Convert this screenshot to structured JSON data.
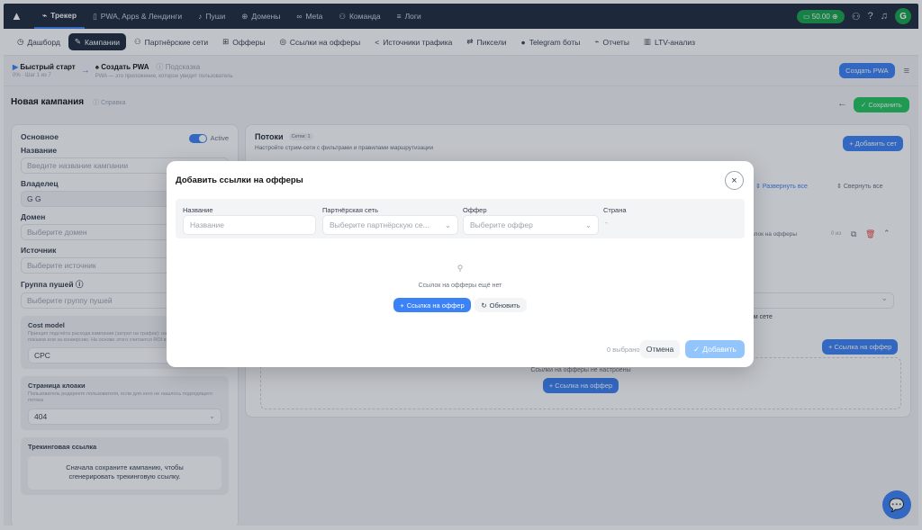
{
  "topnav": {
    "items": [
      {
        "label": "Трекер",
        "icon": "chart-icon"
      },
      {
        "label": "PWA, Apps & Лендинги",
        "icon": "phone-icon"
      },
      {
        "label": "Пуши",
        "icon": "bell-icon"
      },
      {
        "label": "Домены",
        "icon": "globe-icon"
      },
      {
        "label": "Meta",
        "icon": "infinity-icon"
      },
      {
        "label": "Команда",
        "icon": "users-icon"
      },
      {
        "label": "Логи",
        "icon": "list-icon"
      }
    ],
    "balance": "50.00",
    "avatar": "G"
  },
  "subnav": {
    "items": [
      {
        "label": "Дашборд",
        "icon": "clock-icon"
      },
      {
        "label": "Кампании",
        "icon": "edit-icon"
      },
      {
        "label": "Партнёрские сети",
        "icon": "users-icon"
      },
      {
        "label": "Офферы",
        "icon": "gift-icon"
      },
      {
        "label": "Ссылки на офферы",
        "icon": "pin-icon"
      },
      {
        "label": "Источники трафика",
        "icon": "share-icon"
      },
      {
        "label": "Пиксели",
        "icon": "arrows-icon"
      },
      {
        "label": "Telegram боты",
        "icon": "telegram-icon"
      },
      {
        "label": "Отчеты",
        "icon": "chart-icon"
      },
      {
        "label": "LTV-анализ",
        "icon": "bars-icon"
      }
    ]
  },
  "quickstart": {
    "title": "Быстрый старт",
    "progress": "0% · Шаг 1 из 7",
    "step": "Создать PWA",
    "hint_title": "Подсказка",
    "hint": "PWA — это приложение, которое увидит пользователь",
    "create_btn": "Создать PWA"
  },
  "page": {
    "title": "Новая кампания",
    "help": "Справка",
    "save": "Сохранить"
  },
  "left": {
    "section": "Основное",
    "active": "Active",
    "name_label": "Название",
    "name_ph": "Введите название кампании",
    "owner_label": "Владелец",
    "owner_value": "G G",
    "domain_label": "Домен",
    "domain_ph": "Выберите домен",
    "source_label": "Источник",
    "source_ph": "Выберите источник",
    "push_label": "Группа пушей",
    "push_ph": "Выберите группу пушей",
    "cost_title": "Cost model",
    "cost_desc": "Принцип подсчёта расхода кампании (затрат на трафик): на каждую тысячу показов или за конверсию. На основе этого считается ROI в клиент.",
    "cost_value": "CPC",
    "cloak_title": "Страница клоаки",
    "cloak_desc": "Пользователь редиректе пользователя, если для него не нашлось подходящего потока",
    "cloak_value": "404",
    "track_title": "Трекинговая ссылка",
    "track_desc": "Сначала сохраните кампанию, чтобы сгенерировать трекинговую ссылку."
  },
  "right": {
    "title": "Потоки",
    "badge": "Сетки: 1",
    "desc": "Настройте стрим-сети с фильтрами и правилами маршрутизации",
    "add_set": "Добавить сет",
    "expand": "Развернуть все",
    "collapse": "Свернуть все",
    "row_text": "ылок на офферы",
    "count": "0 из",
    "settings": "ом сете",
    "add_link": "Ссылка на оффер",
    "empty": "Ссылки на офферы не настроены"
  },
  "modal": {
    "title": "Добавить ссылки на офферы",
    "col_name": "Название",
    "col_network": "Партнёрская сеть",
    "col_offer": "Оффер",
    "col_country": "Страна",
    "name_ph": "Название",
    "network_ph": "Выберите партнёрскую се...",
    "offer_ph": "Выберите оффер",
    "country_value": "-",
    "empty_text": "Ссылок на офферы ещё нет",
    "add_link": "Ссылка на оффер",
    "refresh": "Обновить",
    "selected": "0 выбрано",
    "cancel": "Отмена",
    "add": "Добавить"
  }
}
